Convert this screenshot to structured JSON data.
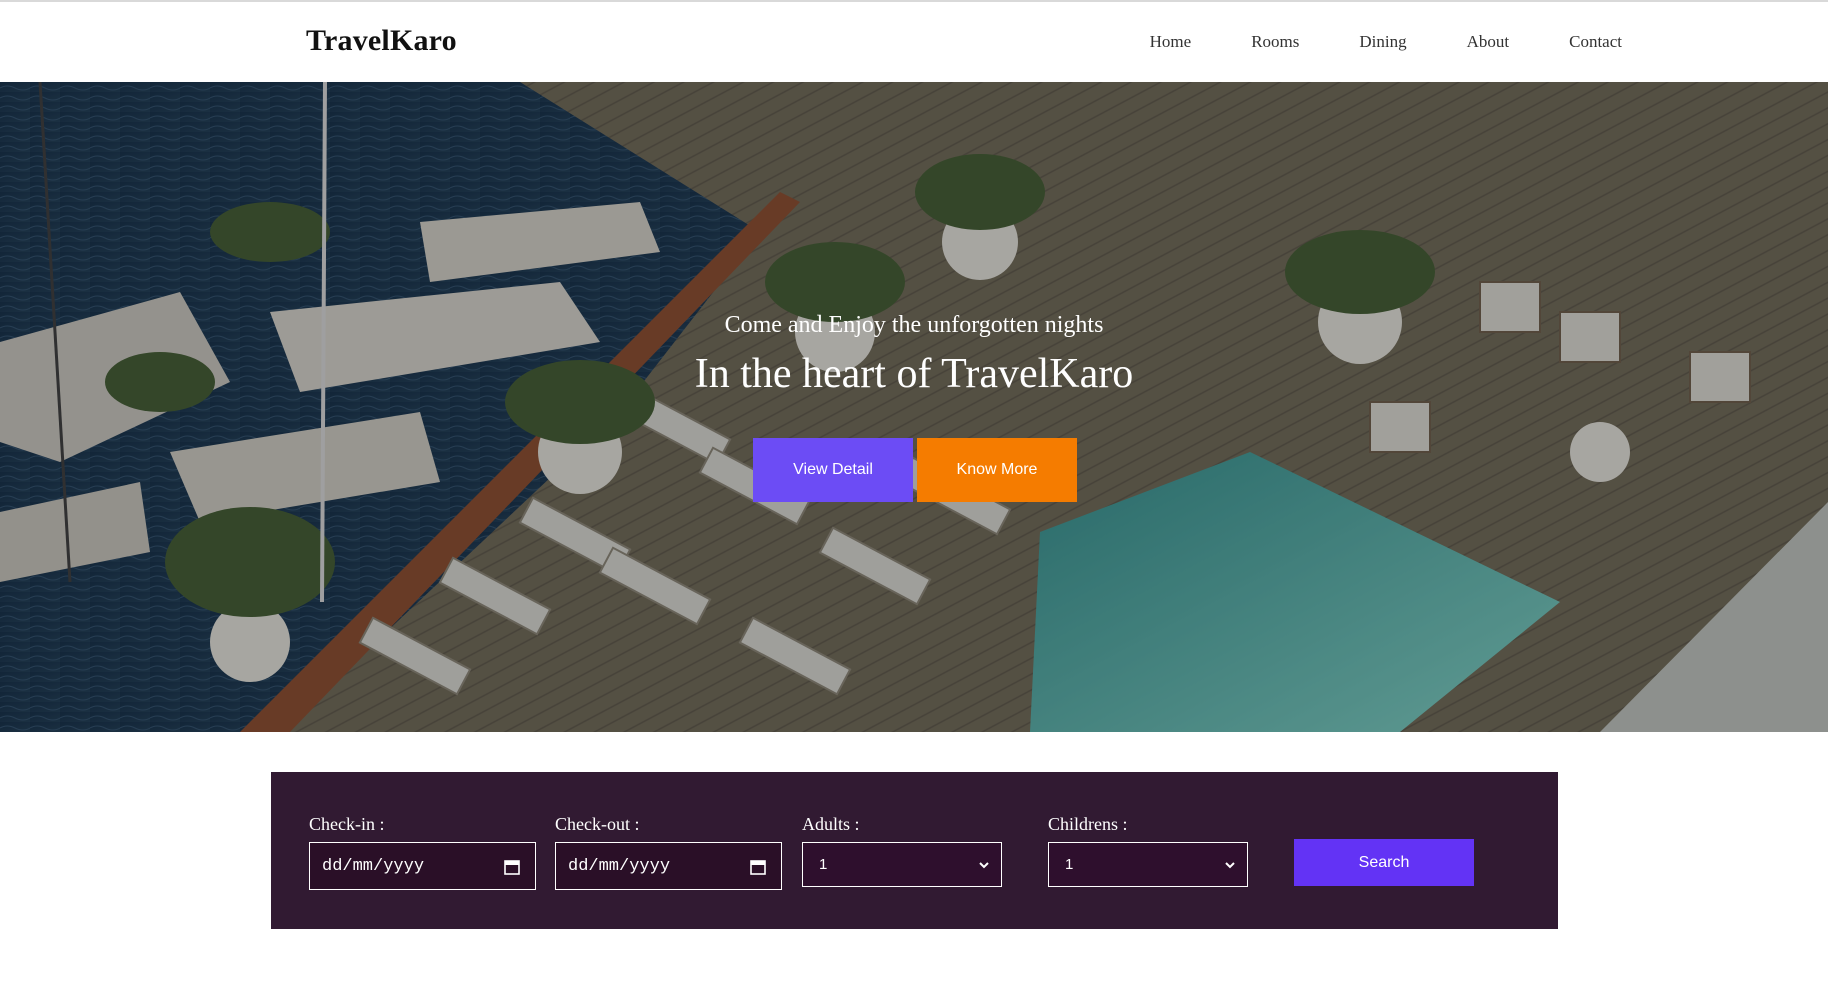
{
  "brand": "TravelKaro",
  "nav": {
    "items": [
      "Home",
      "Rooms",
      "Dining",
      "About",
      "Contact"
    ]
  },
  "hero": {
    "subtitle": "Come and Enjoy the unforgotten nights",
    "title": "In the heart of TravelKaro",
    "view_detail_label": "View Detail",
    "know_more_label": "Know More"
  },
  "booking": {
    "checkin_label": "Check-in :",
    "checkin_value": "dd/mm/yyyy",
    "checkout_label": "Check-out :",
    "checkout_value": "dd/mm/yyyy",
    "adults_label": "Adults :",
    "adults_value": "1",
    "children_label": "Childrens :",
    "children_value": "1",
    "search_label": "Search"
  },
  "colors": {
    "primary_button": "#6c4cf5",
    "secondary_button": "#f57c00",
    "booking_panel": "#311a32",
    "search_button": "#6333f5"
  }
}
